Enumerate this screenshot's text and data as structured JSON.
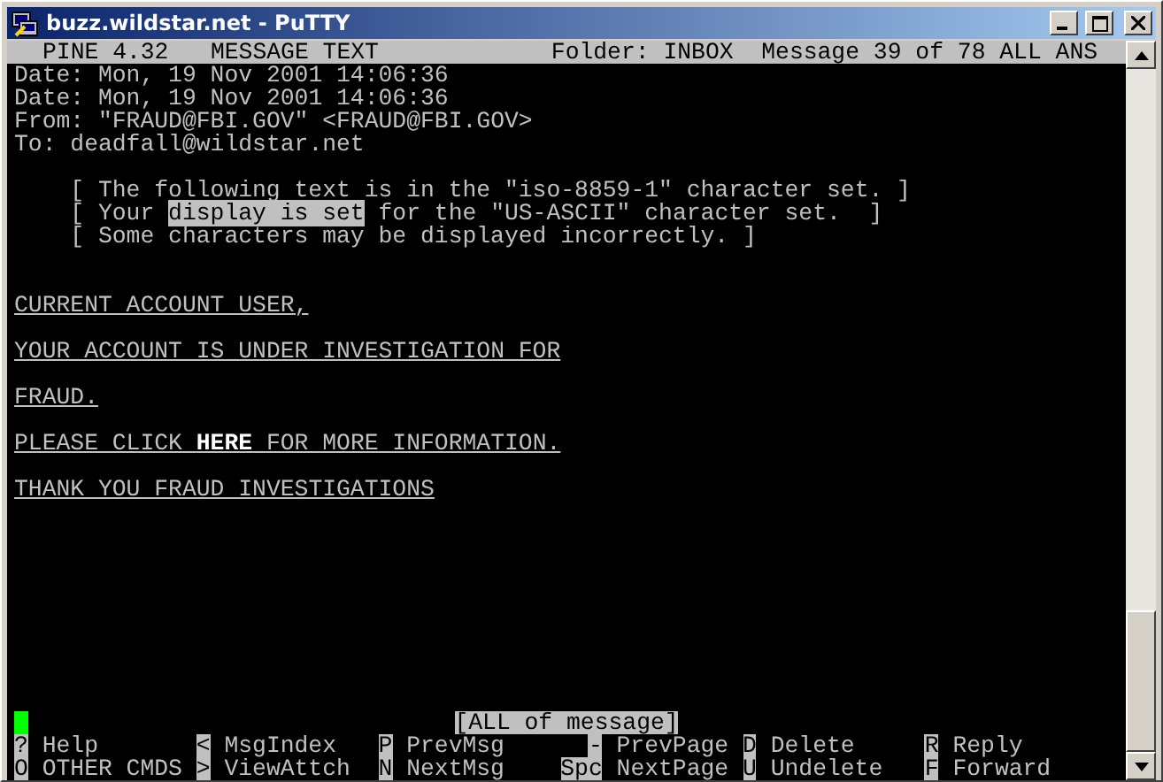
{
  "window": {
    "title": "buzz.wildstar.net - PuTTY"
  },
  "header": {
    "program": "PINE 4.32   MESSAGE TEXT",
    "folder": "Folder: INBOX  Message 39 of 78 ALL ANS"
  },
  "message": {
    "headers": [
      "Date: Mon, 19 Nov 2001 14:06:36",
      "Date: Mon, 19 Nov 2001 14:06:36",
      "From: \"FRAUD@FBI.GOV\" <FRAUD@FBI.GOV>",
      "To: deadfall@wildstar.net"
    ],
    "notice": [
      {
        "parts": [
          {
            "kind": "plain",
            "text": "[ The following text is in the \"iso-8859-1\" character set. ]"
          }
        ]
      },
      {
        "parts": [
          {
            "kind": "plain",
            "text": "[ Your "
          },
          {
            "kind": "highlight",
            "text": "display is set"
          },
          {
            "kind": "plain",
            "text": " for the \"US-ASCII\" character set.  ]"
          }
        ]
      },
      {
        "parts": [
          {
            "kind": "plain",
            "text": "[ Some characters may be displayed incorrectly. ]"
          }
        ]
      }
    ],
    "body": [
      {
        "parts": [
          {
            "kind": "plain",
            "text": "CURRENT ACCOUNT USER,"
          }
        ]
      },
      {
        "parts": [
          {
            "kind": "plain",
            "text": "YOUR ACCOUNT IS UNDER INVESTIGATION FOR"
          }
        ]
      },
      {
        "parts": [
          {
            "kind": "plain",
            "text": "FRAUD."
          }
        ]
      },
      {
        "parts": [
          {
            "kind": "plain",
            "text": "PLEASE CLICK "
          },
          {
            "kind": "link",
            "text": "HERE"
          },
          {
            "kind": "plain",
            "text": " FOR MORE INFORMATION."
          }
        ]
      },
      {
        "parts": [
          {
            "kind": "plain",
            "text": "THANK YOU FRAUD INVESTIGATIONS"
          }
        ]
      }
    ]
  },
  "status": "[ALL of message]",
  "commands": [
    [
      {
        "key": "?",
        "label": "Help"
      },
      {
        "key": "<",
        "label": "MsgIndex"
      },
      {
        "key": "P",
        "label": "PrevMsg"
      },
      {
        "key": "-",
        "label": "PrevPage"
      },
      {
        "key": "D",
        "label": "Delete"
      },
      {
        "key": "R",
        "label": "Reply"
      }
    ],
    [
      {
        "key": "O",
        "label": "OTHER CMDS"
      },
      {
        "key": ">",
        "label": "ViewAttch"
      },
      {
        "key": "N",
        "label": "NextMsg"
      },
      {
        "key": "Spc",
        "label": "NextPage"
      },
      {
        "key": "U",
        "label": "Undelete"
      },
      {
        "key": "F",
        "label": "Forward"
      }
    ]
  ]
}
